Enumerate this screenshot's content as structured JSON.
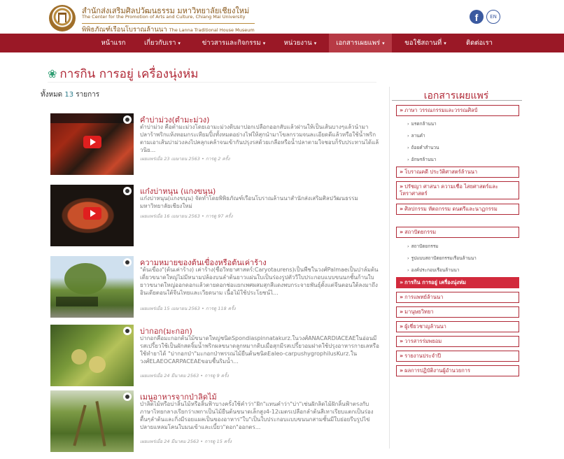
{
  "header": {
    "org_thai": "สำนักส่งเสริมศิลปวัฒนธรรม มหาวิทยาลัยเชียงใหม่",
    "org_en": "The Center for the Promotion of Arts and Culture, Chiang Mai University",
    "museum_thai": "พิพิธภัณฑ์เรือนโบราณล้านนา",
    "museum_en": "The Lanna Traditional House Museum",
    "facebook_glyph": "f",
    "lang_label": "EN"
  },
  "nav": [
    {
      "label": "หน้าแรก",
      "caret": ""
    },
    {
      "label": "เกี่ยวกับเรา",
      "caret": "▾"
    },
    {
      "label": "ข่าวสารและกิจกรรม",
      "caret": "▾"
    },
    {
      "label": "หน่วยงาน",
      "caret": "▾"
    },
    {
      "label": "เอกสารเผยแพร่",
      "caret": "▾"
    },
    {
      "label": "ขอใช้สถานที่",
      "caret": "▾"
    },
    {
      "label": "ติดต่อเรา",
      "caret": ""
    }
  ],
  "page": {
    "title": "การกิน การอยู่ เครื่องนุ่งห่ม",
    "flower": "❀",
    "count_prefix": "ทั้งหมด",
    "count_value": "13",
    "count_suffix": "รายการ"
  },
  "articles": [
    {
      "title": "คำบ่าม่วง(ตำมะม่วง)",
      "desc": "ตำบ่าม่วง คือตำมะม่วงโดยเอามะม่วงดิบมาปอกเปลือกออกสับแล้วฝานให้เป็นเส้นบางๆแล้วนำมาปลาร้าพริกแห้งหอมกระเทียมปิ้งทั้งหมดอย่างไฟให้สุกนำมาโขลกรวมจนละเอียดดีแล้วหรือใช้น้ำพริกตามเอาเส้นบ่าม่วงลงไปคลุกเคล้าจนเข้ากันปรุงรสด้วยเกลือหรือน้ำปลาตามใจชอบก็รับประทานได้แล้วนิย...",
      "meta": "เผยแพร่เมื่อ 23 เมษายน 2563 • การดู 2 ครั้ง",
      "thumb": "video"
    },
    {
      "title": "แก๋งบ่าหนุน (แกงขนุน)",
      "desc": "แก๋งบ่าหนุน(แกงขนุน) จัดทำโดยพิพิธภัณฑ์เรือนโบราณล้านนาสำนักส่งเสริมศิลปวัฒนธรรมมหาวิทยาลัยเชียงใหม่",
      "meta": "เผยแพร่เมื่อ 16 เมษายน 2563 • การดู 97 ครั้ง",
      "thumb": "video"
    },
    {
      "title": "ความหมายของต้นเขื่องหรือต้นเค่าร้าง",
      "desc": "\"ต้นเขื่อง\"(ต้นเค่าร้าง) เค่าร้าง(ชื่อวิทยาศาสตร์:Caryotaurens)เป็นพืชในวงศ์Palmaeเป็นปาล์มต้นเดี่ยวขนาดใหญ่ไม่มีหนามปล้องบนลำต้นยาวแผ่นใบเป็นร่องรูปตัววีใบประกอบแบบขนนกชั้นก้านใบยาวขนาดใหญ่ออกดอกแล้วตายดอกช่อแยกเพศผสมสุกสีแดงพบกระจายพันธุ์ตั้งแต่จีนตอนใต้ลงมาถึงอินเดียตอนใต้จีนไทยและเวียดนาม เนื้อไม้ใช้ประโยชน์ไ...",
      "meta": "เผยแพร่เมื่อ 15 เมษายน 2563 • การดู 118 ครั้ง",
      "thumb": "photo-tree"
    },
    {
      "title": "บ่ากอก(มะกอก)",
      "desc": "บ่ากอกคือมะกอกต้นไม้ขนาดใหญ่ชนิดSpondiaspinnatakurz.ในวงศ์ANACARDIACEAEในอ่อนมีรสเปรี้ยวใช้เป็นผักสดจิ้มน้ำพริกผลขนาดลูกหมากดิบเมื่อสุกมีรสเปรี้ยวอมฝาดใช้ปรุงอาหารกายเลหรือใช้ทำยาได้ \"บ่ากอกป่า\"มะกอกป่าพรรณไม้ยืนต้นชนิดEaleo-carpushygrophilusKurz.ในวงศ์ELAEOCARPACEAEขอบชื้นริมน้ำ...",
      "meta": "เผยแพร่เมื่อ 24 มีนาคม 2563 • การดู 9 ครั้ง",
      "thumb": "photo-fruit"
    },
    {
      "title": "เมนูอาหารจากป่าลิดไม้",
      "desc": "ป่าลิดไม้หรือบ่าลิ้นไม้หรือลิ้นฟ้าบางครั้งใช้คำว่า\"ฝัก\"แทนคำว่า\"บ่า\"เช่นฝักลิดไม้ฝักลิ้นฟ้าตรงกับภาษาไทยกลางเรียกว่าเพกาเป็นไม้ยืนต้นขนาดเล็กสูง4-12เมตรเปลือกลำต้นสีเทาเรียบแตกเป็นร่องตื้นๆลำต้นและกิ่งมีรอยแผลเป็นของอาหาร\"ใบ\"เป็นใบประกอบแบบขนนกสามชั้นมีใบย่อยรีบรูปไข่ปลายแหลมโคนใบมนเข้าและเบี้ยว\"ดอก\"ออกตร...",
      "meta": "เผยแพร่เมื่อ 24 มีนาคม 2563 • การดู 15 ครั้ง",
      "thumb": "photo-pods"
    }
  ],
  "sidebar": {
    "title": "เอกสารเผยแพร่",
    "menu_glyph": "»",
    "sections": [
      {
        "label": "ภาษา วรรณกรรมและวรรณศิลป์",
        "subs": [
          "มรดกล้านนา",
          "ลานคำ",
          "ถ้อยคำสำนวน",
          "อักษรล้านนา"
        ]
      },
      {
        "label": "โบราณคดี ประวัติศาสตร์ล้านนา",
        "subs": []
      },
      {
        "label": "ปรัชญา ศาสนา ความเชื่อ ไสยศาสตร์และโหราศาสตร์",
        "subs": []
      },
      {
        "label": "ศิลปกรรม หัตถกรรม ดนตรีและนาฏกรรม",
        "subs": []
      },
      {
        "label": "สถาปัตยกรรม",
        "subs": [
          "สถาปัตยกรรม",
          "รูปแบบสถาปัตยกรรมเรือนล้านนา",
          "องค์ประกอบเรือนล้านนา"
        ]
      },
      {
        "label": "การกิน การอยู่ เครื่องนุ่งห่ม",
        "subs": [],
        "active": true
      },
      {
        "label": "การแพทย์ล้านนา",
        "subs": []
      },
      {
        "label": "มานุษยวิทยา",
        "subs": []
      },
      {
        "label": "ผู้เชี่ยวชาญล้านนา",
        "subs": []
      },
      {
        "label": "วารสารร่มพยอม",
        "subs": []
      },
      {
        "label": "รายงานประจำปี",
        "subs": []
      },
      {
        "label": "ผลการปฏิบัติงานผู้อำนวยการ",
        "subs": []
      }
    ]
  }
}
